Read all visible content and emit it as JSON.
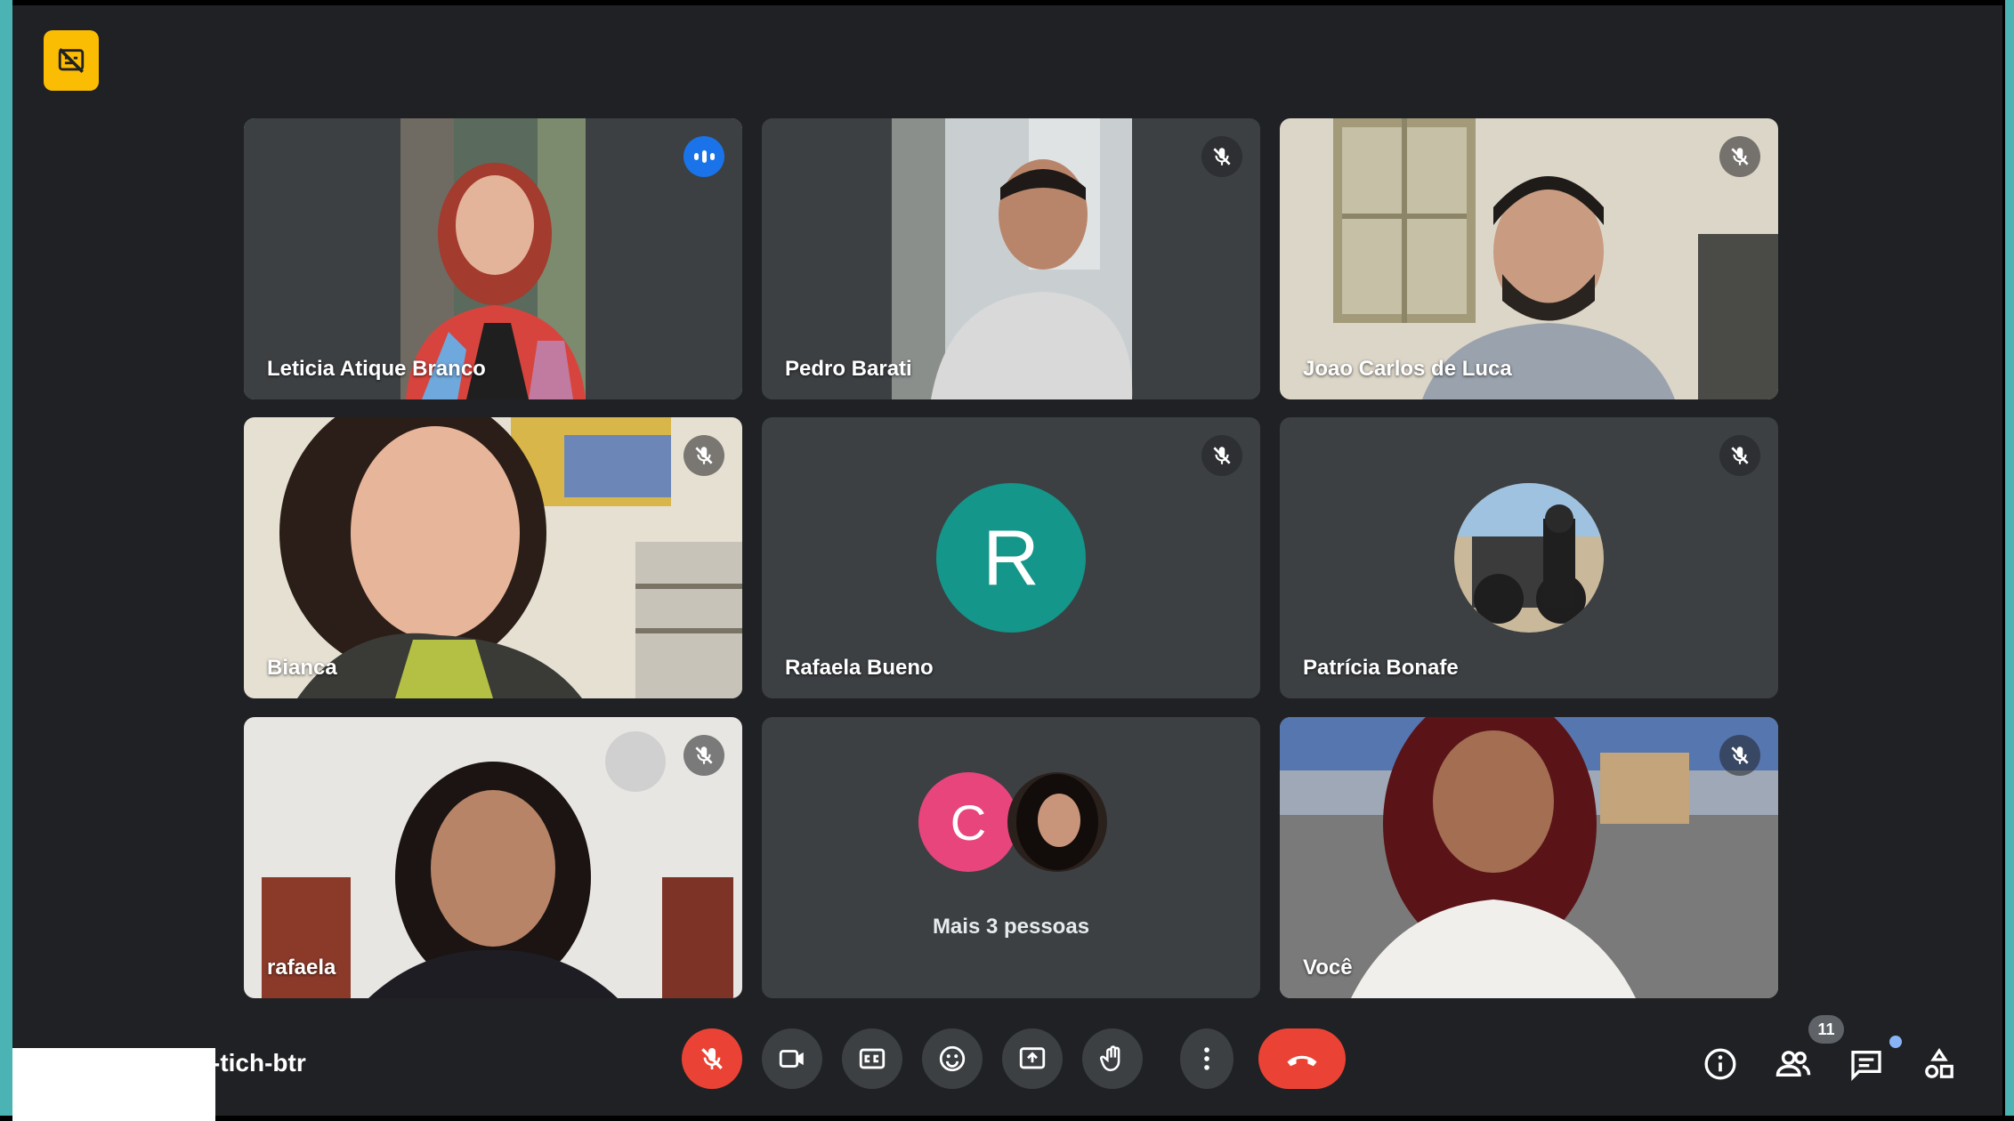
{
  "meeting": {
    "code_fragment": "-tich-btr"
  },
  "participants_count": "11",
  "tiles": [
    {
      "name": "Leticia Atique Branco",
      "state": "speaking"
    },
    {
      "name": "Pedro Barati",
      "state": "muted"
    },
    {
      "name": "Joao Carlos de Luca",
      "state": "muted"
    },
    {
      "name": "Bianca",
      "state": "muted"
    },
    {
      "name": "Rafaela Bueno",
      "state": "muted",
      "avatar_letter": "R",
      "avatar_color": "#14968a"
    },
    {
      "name": "Patrícia Bonafe",
      "state": "muted"
    },
    {
      "name": "rafaela",
      "state": "muted"
    },
    {
      "more_label": "Mais 3 pessoas",
      "avatar_letter": "C",
      "avatar_color": "#e8457c"
    },
    {
      "name": "Você",
      "state": "muted"
    }
  ],
  "controls": [
    "mic-off-icon",
    "camera-icon",
    "captions-icon",
    "emoji-icon",
    "present-icon",
    "raise-hand-icon",
    "more-options-icon",
    "hang-up-icon"
  ],
  "right_controls": [
    "info-icon",
    "people-icon",
    "chat-icon",
    "activities-icon"
  ],
  "colors": {
    "accent": "#8ab4f8",
    "danger": "#ea4335",
    "badge": "#fbbc04",
    "tile": "#3c4043",
    "background": "#202124"
  }
}
